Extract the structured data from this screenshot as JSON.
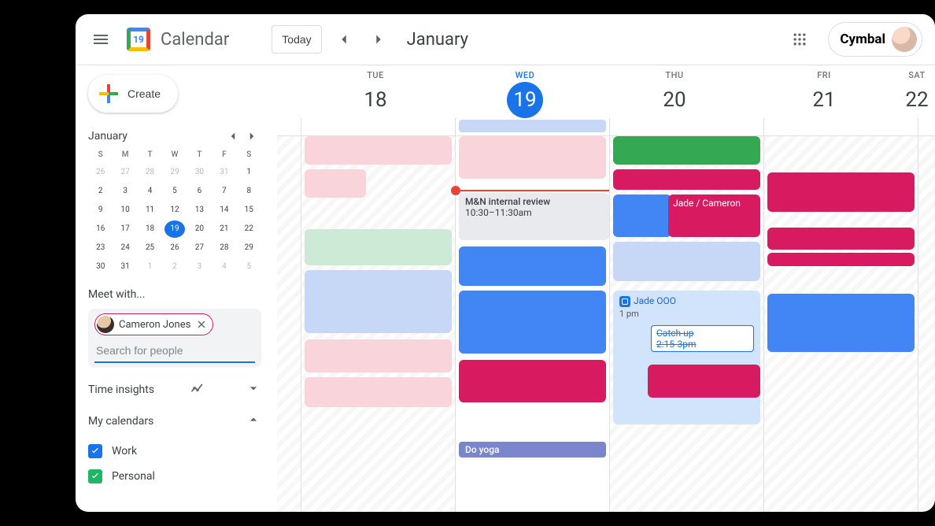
{
  "header": {
    "app_title": "Calendar",
    "logo_date": "19",
    "today_label": "Today",
    "month_title": "January",
    "brand": "Cymbal"
  },
  "sidebar": {
    "create_label": "Create",
    "mini_month": "January",
    "dow": [
      "S",
      "M",
      "T",
      "W",
      "T",
      "F",
      "S"
    ],
    "weeks": [
      [
        {
          "n": "26",
          "o": true
        },
        {
          "n": "27",
          "o": true
        },
        {
          "n": "28",
          "o": true
        },
        {
          "n": "29",
          "o": true
        },
        {
          "n": "30",
          "o": true
        },
        {
          "n": "31",
          "o": true
        },
        {
          "n": "1"
        }
      ],
      [
        {
          "n": "2"
        },
        {
          "n": "3"
        },
        {
          "n": "4"
        },
        {
          "n": "5"
        },
        {
          "n": "6"
        },
        {
          "n": "7"
        },
        {
          "n": "8"
        }
      ],
      [
        {
          "n": "9"
        },
        {
          "n": "10"
        },
        {
          "n": "11"
        },
        {
          "n": "12"
        },
        {
          "n": "13"
        },
        {
          "n": "14"
        },
        {
          "n": "15"
        }
      ],
      [
        {
          "n": "16"
        },
        {
          "n": "17"
        },
        {
          "n": "18"
        },
        {
          "n": "19",
          "today": true
        },
        {
          "n": "20"
        },
        {
          "n": "21"
        },
        {
          "n": "22"
        }
      ],
      [
        {
          "n": "23"
        },
        {
          "n": "24"
        },
        {
          "n": "25"
        },
        {
          "n": "26"
        },
        {
          "n": "27"
        },
        {
          "n": "28"
        },
        {
          "n": "29"
        }
      ],
      [
        {
          "n": "30"
        },
        {
          "n": "31"
        },
        {
          "n": "1",
          "o": true
        },
        {
          "n": "2",
          "o": true
        },
        {
          "n": "3",
          "o": true
        },
        {
          "n": "4",
          "o": true
        },
        {
          "n": "5",
          "o": true
        }
      ]
    ],
    "meet_with_label": "Meet with...",
    "chip_name": "Cameron Jones",
    "search_placeholder": "Search for people",
    "time_insights_label": "Time insights",
    "my_calendars_label": "My calendars",
    "calendars": [
      {
        "label": "Work",
        "color": "blue"
      },
      {
        "label": "Personal",
        "color": "green"
      }
    ]
  },
  "grid": {
    "days": [
      {
        "dow": "TUE",
        "dom": "18"
      },
      {
        "dow": "WED",
        "dom": "19",
        "today": true
      },
      {
        "dow": "THU",
        "dom": "20"
      },
      {
        "dow": "FRI",
        "dom": "21"
      },
      {
        "dow": "SAT",
        "dom": "22"
      }
    ],
    "review_title": "M&N internal review",
    "review_time": "10:30–11:30am",
    "jade_cameron": "Jade / Cameron",
    "jade_ooo": "Jade OOO",
    "jade_ooo_time": "1 pm",
    "catchup_title": "Catch up",
    "catchup_time": "2:15-3pm",
    "yoga": "Do yoga"
  },
  "colors": {
    "pink": "#f9d5db",
    "magenta": "#d81b60",
    "blue": "#4285f4",
    "blueOutline": "#d2e3fc",
    "green": "#34a853",
    "mint": "#cdead7",
    "lavender": "#7986cb"
  }
}
